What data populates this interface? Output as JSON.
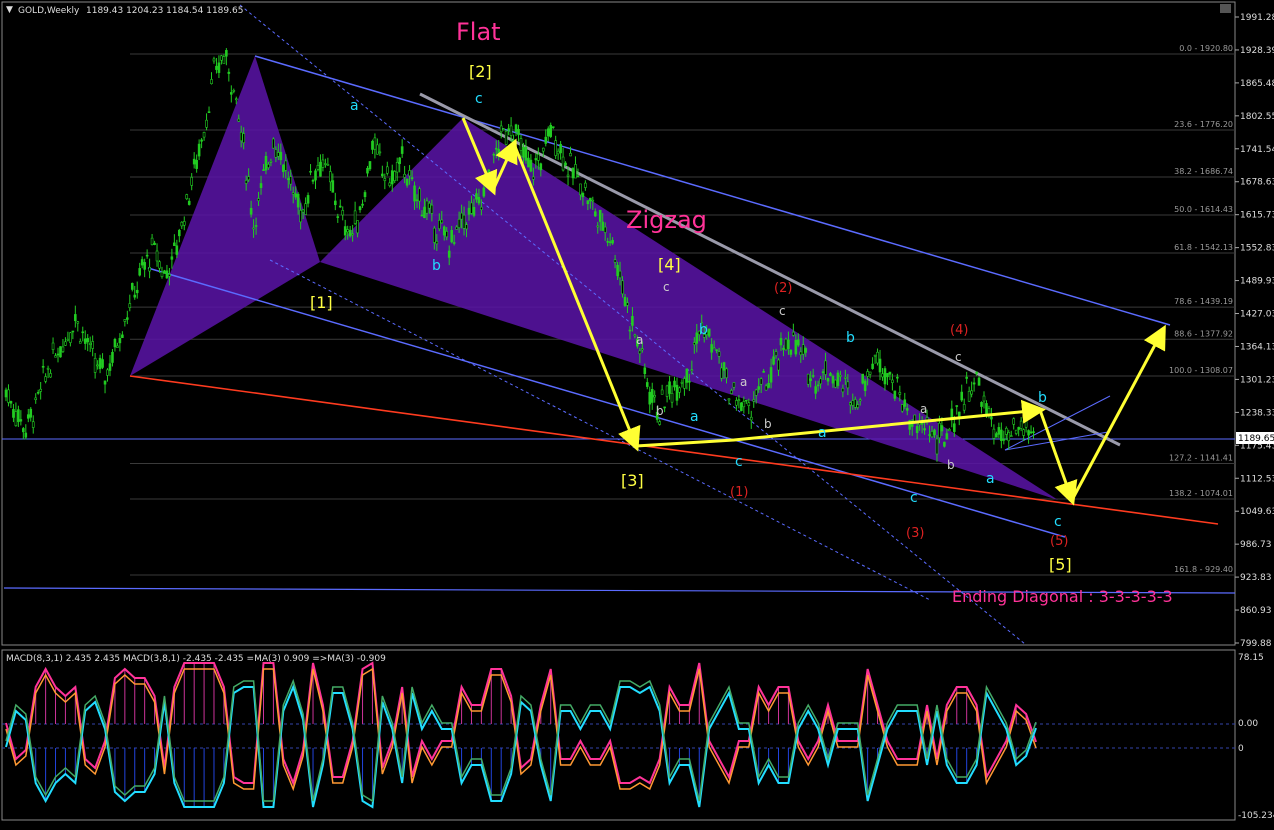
{
  "window": {
    "title": "GOLD,Weekly",
    "ohlc": "1189.43 1204.23 1184.54 1189.65",
    "current_price": "1189.65"
  },
  "price_axis": {
    "labels": [
      "1991.28",
      "1928.39",
      "1865.48",
      "1802.55",
      "1741.54",
      "1678.63",
      "1615.73",
      "1552.83",
      "1489.93",
      "1427.03",
      "1364.13",
      "1301.23",
      "1238.33",
      "1175.43",
      "1112.53",
      "1049.63",
      "986.73",
      "923.83",
      "860.93",
      "799.88"
    ],
    "range": [
      799.88,
      1991.28
    ]
  },
  "fib_levels": [
    {
      "label": "0.0 - 1920.80",
      "value": 1920.8
    },
    {
      "label": "23.6 - 1776.20",
      "value": 1776.2
    },
    {
      "label": "38.2 - 1686.74",
      "value": 1686.74
    },
    {
      "label": "50.0 - 1614.43",
      "value": 1614.43
    },
    {
      "label": "61.8 - 1542.13",
      "value": 1542.13
    },
    {
      "label": "78.6 - 1439.19",
      "value": 1439.19
    },
    {
      "label": "88.6 - 1377.92",
      "value": 1377.92
    },
    {
      "label": "100.0 - 1308.07",
      "value": 1308.07
    },
    {
      "label": "127.2 - 1141.41",
      "value": 1141.41
    },
    {
      "label": "138.2 - 1074.01",
      "value": 1074.01
    },
    {
      "label": "161.8 - 929.40",
      "value": 929.4
    }
  ],
  "annotations": {
    "flat": "Flat",
    "zigzag": "Zigzag",
    "ending_diagonal": "Ending Diagonal : 3-3-3-3-3",
    "w1": "[1]",
    "w2": "[2]",
    "w3": "[3]",
    "w4": "[4]",
    "w5": "[5]",
    "r1": "(1)",
    "r2": "(2)",
    "r3": "(3)",
    "r4": "(4)",
    "r5": "(5)",
    "a": "a",
    "b": "b",
    "c": "c"
  },
  "macd": {
    "header": "MACD(8,3,1) 2.435 2.435   MACD(3,8,1) -2.435 -2.435   =MA(3) 0.909   =>MA(3) -0.909",
    "axis": [
      "78.15",
      "0.00",
      "0",
      "-105.234"
    ]
  },
  "colors": {
    "background": "#000000",
    "bull_candle": "#22cc22",
    "channel": "#5b6bff",
    "triangle": "#5a14a8",
    "path": "#ffff33",
    "red_line": "#ff3b1f",
    "grey_line": "#9a9aaa",
    "flat_text": "#ff3399",
    "cyan_label": "#22ddff",
    "red_label": "#dd2222"
  },
  "chart_data": {
    "type": "line",
    "title": "GOLD,Weekly",
    "xlabel": "",
    "ylabel": "",
    "ylim": [
      799.88,
      1991.28
    ],
    "series": [
      {
        "name": "",
        "values": [
          1280,
          1240,
          1210,
          1250,
          1310,
          1350,
          1380,
          1420,
          1380,
          1330,
          1310,
          1360,
          1420,
          1470,
          1520,
          1550,
          1500,
          1540,
          1620,
          1700,
          1780,
          1880,
          1920,
          1860,
          1740,
          1600,
          1680,
          1760,
          1720,
          1650,
          1620,
          1700,
          1720,
          1660,
          1600,
          1580,
          1640,
          1750,
          1700,
          1680,
          1720,
          1660,
          1640,
          1600,
          1580,
          1560,
          1600,
          1620,
          1640,
          1700,
          1760,
          1790,
          1740,
          1700,
          1720,
          1780,
          1740,
          1700,
          1680,
          1640,
          1600,
          1580,
          1500,
          1420,
          1360,
          1280,
          1240,
          1280,
          1300,
          1320,
          1400,
          1380,
          1340,
          1280,
          1260,
          1240,
          1280,
          1300,
          1340,
          1380,
          1360,
          1320,
          1300,
          1320,
          1300,
          1280,
          1260,
          1320,
          1340,
          1320,
          1280,
          1240,
          1200,
          1220,
          1180,
          1200,
          1240,
          1280,
          1300,
          1240,
          1200,
          1180,
          1200,
          1210,
          1189
        ]
      }
    ]
  }
}
